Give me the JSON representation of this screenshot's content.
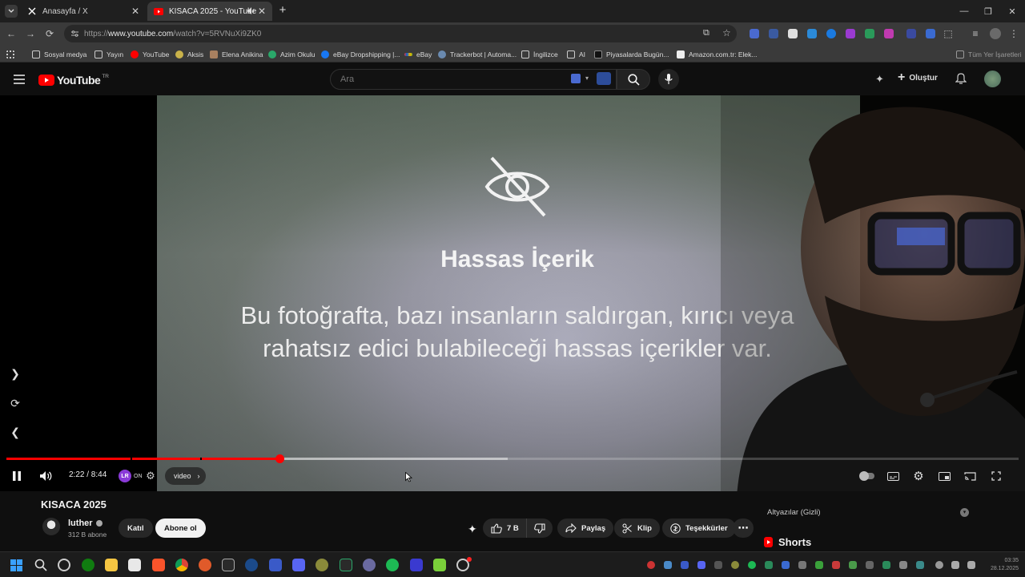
{
  "browser": {
    "tabs": [
      {
        "title": "Anasayfa / X",
        "active": false
      },
      {
        "title": "KISACA 2025 - YouTube",
        "active": true
      }
    ],
    "url_prefix": "https://",
    "url_host": "www.youtube.com",
    "url_path": "/watch?v=5RVNuXi9ZK0",
    "bookmarks": [
      "Sosyal medya",
      "Yayın",
      "YouTube",
      "Aksis",
      "Elena Anikina",
      "Azim Okulu",
      "eBay Dropshipping |...",
      "eBay",
      "Trackerbot | Automa...",
      "İngilizce",
      "AI",
      "Piyasalarda Bugün...",
      "Amazon.com.tr: Elek..."
    ],
    "all_bookmarks": "Tüm Yer İşaretleri"
  },
  "youtube": {
    "logo": "YouTube",
    "region": "TR",
    "search_placeholder": "Ara",
    "create_label": "Oluştur"
  },
  "player": {
    "overlay_title": "Hassas İçerik",
    "overlay_body": "Bu fotoğrafta, bazı insanların saldırgan, kırıcı veya rahatsız edici bulabileceği hassas içerikler var.",
    "time": "2:22 / 8:44",
    "progress_fraction": 0.27,
    "buffered_fraction": 0.495,
    "ext_state": "ON",
    "chapter": "video"
  },
  "video": {
    "title": "KISACA 2025",
    "channel": "luther",
    "subscribers": "312 B abone",
    "join_label": "Katıl",
    "subscribe_label": "Abone ol",
    "likes": "7 B",
    "share_label": "Paylaş",
    "clip_label": "Klip",
    "thanks_label": "Teşekkürler"
  },
  "sidebar": {
    "captions": "Altyazılar (Gizli)",
    "shorts": "Shorts"
  },
  "clock": {
    "time": "03:35",
    "date": "28.12.2025"
  }
}
